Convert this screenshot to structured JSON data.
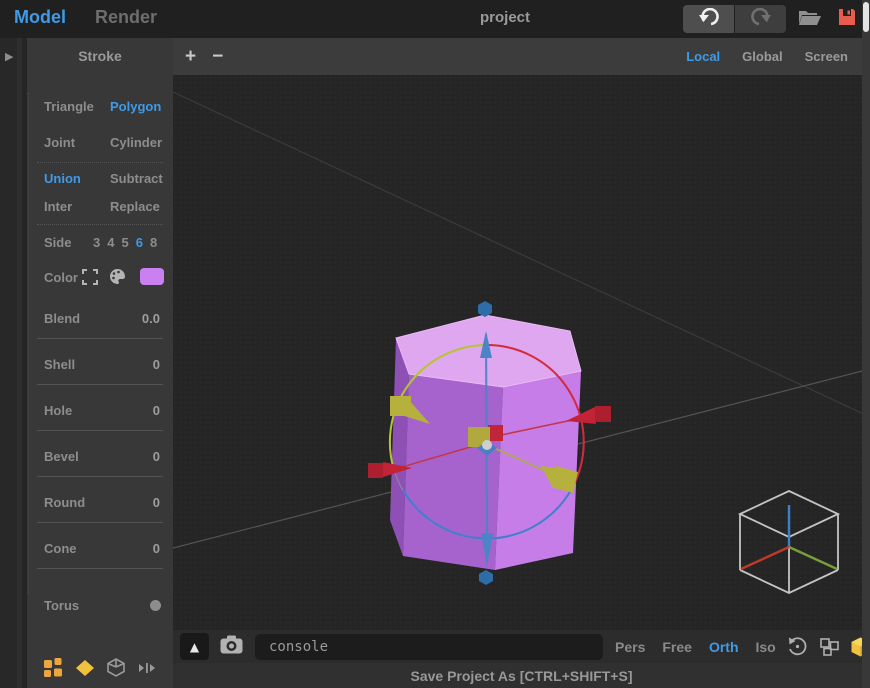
{
  "topbar": {
    "tabs": [
      {
        "label": "Model",
        "active": true
      },
      {
        "label": "Render",
        "active": false
      }
    ],
    "project_title": "project"
  },
  "sidebar": {
    "header": "Stroke",
    "option_rows": [
      [
        {
          "label": "Triangle",
          "selected": false
        },
        {
          "label": "Polygon",
          "selected": true
        }
      ],
      [
        {
          "label": "Joint",
          "selected": false
        },
        {
          "label": "Cylinder",
          "selected": false
        }
      ],
      [
        {
          "label": "Union",
          "selected": true
        },
        {
          "label": "Subtract",
          "selected": false
        }
      ],
      [
        {
          "label": "Inter",
          "selected": false
        },
        {
          "label": "Replace",
          "selected": false
        }
      ]
    ],
    "side": {
      "label": "Side",
      "options": [
        "3",
        "4",
        "5",
        "6",
        "8"
      ],
      "selected": "6"
    },
    "color": {
      "label": "Color",
      "swatch": "#ca80f0"
    },
    "sliders": [
      {
        "label": "Blend",
        "value": "0.0"
      },
      {
        "label": "Shell",
        "value": "0"
      },
      {
        "label": "Hole",
        "value": "0"
      },
      {
        "label": "Bevel",
        "value": "0"
      },
      {
        "label": "Round",
        "value": "0"
      },
      {
        "label": "Cone",
        "value": "0"
      }
    ],
    "torus_label": "Torus"
  },
  "viewport_toolbar": {
    "zoom_in": "+",
    "zoom_out": "−",
    "space_tabs": [
      {
        "label": "Local",
        "active": true
      },
      {
        "label": "Global",
        "active": false
      },
      {
        "label": "Screen",
        "active": false
      }
    ]
  },
  "bottombar": {
    "console_value": "console",
    "view_modes": [
      {
        "label": "Pers",
        "active": false
      },
      {
        "label": "Free",
        "active": false
      },
      {
        "label": "Orth",
        "active": true
      },
      {
        "label": "Iso",
        "active": false
      }
    ]
  },
  "statusbar": {
    "message": "Save Project As [CTRL+SHIFT+S]"
  },
  "icons": {
    "rail_arrow": "▶",
    "expand_triangle": "▲"
  },
  "colors": {
    "accent_blue": "#3f9ae8",
    "color_swatch": "#ca80f0",
    "object_top": "#dfa7ef",
    "object_left": "#8e50b4",
    "object_front": "#a763cd",
    "object_right": "#c77de7",
    "save_icon_red": "#e85c50",
    "gizmo_red": "#c22335",
    "gizmo_yellow": "#b6b13d",
    "gizmo_blue": "#4d84c8",
    "icon_orange": "#eca63e",
    "icon_yellow": "#f0c23e"
  }
}
